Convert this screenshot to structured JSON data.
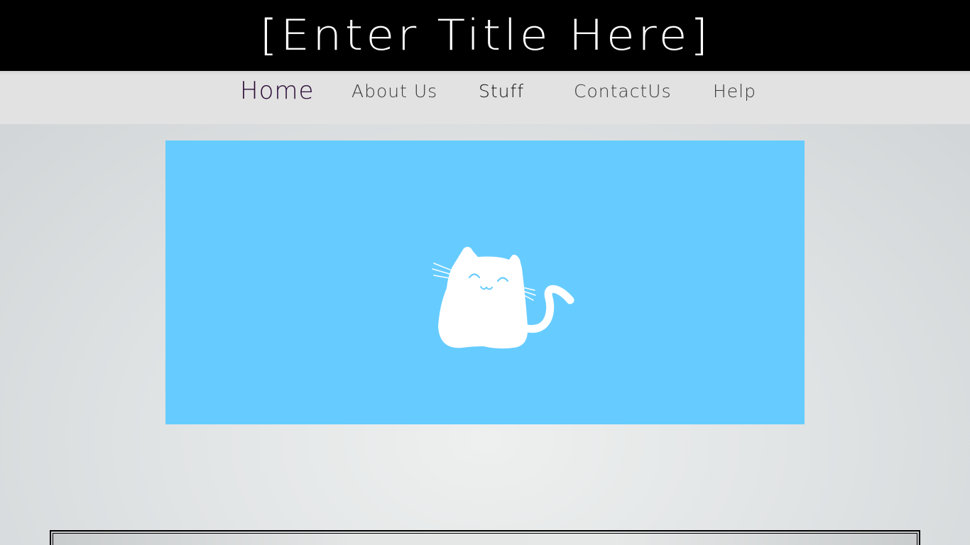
{
  "header": {
    "title": "[Enter Title Here]"
  },
  "nav": {
    "items": [
      {
        "label": "Home",
        "state": "active"
      },
      {
        "label": "About Us"
      },
      {
        "label": "Stuff"
      },
      {
        "label": "ContactUs"
      },
      {
        "label": "Help"
      }
    ]
  },
  "hero": {
    "image": "cat-illustration",
    "background_color": "#66ccff"
  },
  "colors": {
    "header_bg": "#000000",
    "header_text": "#ffffff",
    "nav_bg": "#e2e2e2",
    "nav_active_text": "#2a0a35"
  }
}
